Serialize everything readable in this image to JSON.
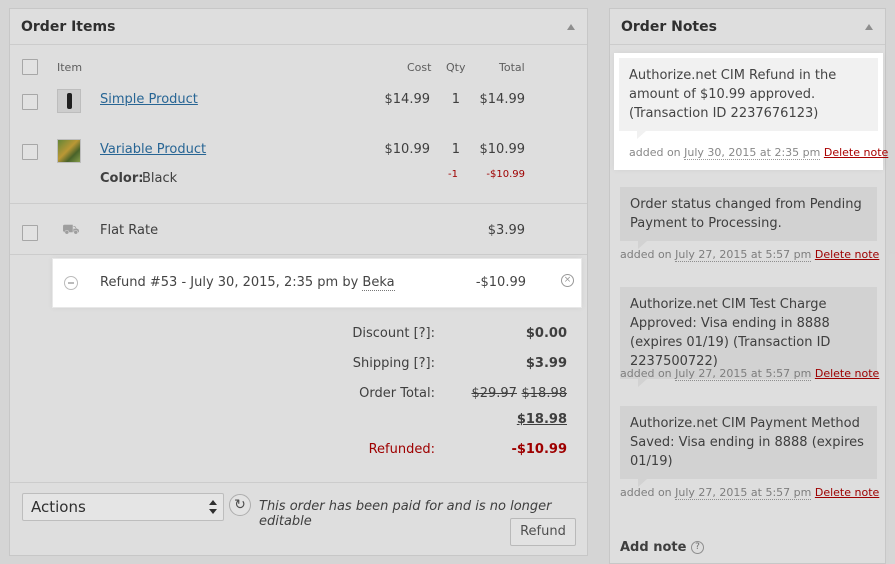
{
  "order_items": {
    "title": "Order Items",
    "columns": {
      "item": "Item",
      "cost": "Cost",
      "qty": "Qty",
      "total": "Total"
    },
    "products": [
      {
        "name": "Simple Product",
        "cost": "$14.99",
        "qty": "1",
        "total": "$14.99"
      },
      {
        "name": "Variable Product",
        "cost": "$10.99",
        "qty": "1",
        "total": "$10.99",
        "attr_label": "Color:",
        "attr_value": "Black",
        "refund_qty": "-1",
        "refund_total": "-$10.99"
      }
    ],
    "shipping": {
      "name": "Flat Rate",
      "total": "$3.99"
    },
    "refund": {
      "text": "Refund #53 - July 30, 2015, 2:35 pm by ",
      "author": "Beka",
      "amount": "-$10.99"
    },
    "totals": {
      "discount_label": "Discount [?]:",
      "discount": "$0.00",
      "shipping_label": "Shipping [?]:",
      "shipping": "$3.99",
      "order_total_label": "Order Total:",
      "order_total_old": "$29.97",
      "order_total_mid": "$18.98",
      "order_total_new": "$18.98",
      "refunded_label": "Refunded:",
      "refunded": "-$10.99"
    },
    "actions": {
      "select_value": "Actions",
      "paid_note": "This order has been paid for and is no longer editable",
      "refund_button": "Refund"
    }
  },
  "order_notes": {
    "title": "Order Notes",
    "notes": [
      {
        "text": "Authorize.net CIM Refund in the amount of $10.99 approved. (Transaction ID 2237676123)",
        "meta_prefix": "added on ",
        "date": "July 30, 2015 at 2:35 pm",
        "delete": "Delete note"
      },
      {
        "text": "Order status changed from Pending Payment to Processing.",
        "meta_prefix": "added on ",
        "date": "July 27, 2015 at 5:57 pm",
        "delete": "Delete note"
      },
      {
        "text": "Authorize.net CIM Test Charge Approved: Visa ending in 8888 (expires 01/19) (Transaction ID 2237500722)",
        "meta_prefix": "added on ",
        "date": "July 27, 2015 at 5:57 pm",
        "delete": "Delete note"
      },
      {
        "text": "Authorize.net CIM Payment Method Saved: Visa ending in 8888 (expires 01/19)",
        "meta_prefix": "added on ",
        "date": "July 27, 2015 at 5:57 pm",
        "delete": "Delete note"
      }
    ],
    "add_note": "Add note",
    "help": "?"
  }
}
